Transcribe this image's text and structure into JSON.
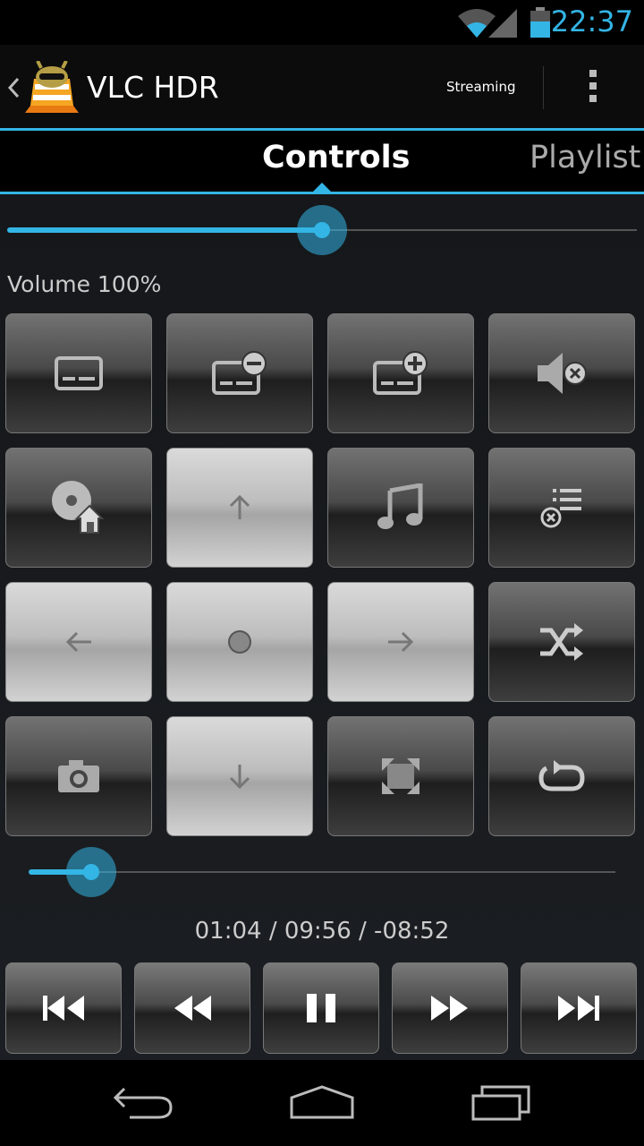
{
  "status_bar": {
    "time": "22:37"
  },
  "action_bar": {
    "title": "VLC HDR",
    "streaming_label": "Streaming"
  },
  "tabs": [
    {
      "label": "Controls",
      "selected": true
    },
    {
      "label": "Playlist",
      "selected": false
    }
  ],
  "volume": {
    "label": "Volume 100%",
    "level": 0.5
  },
  "seek": {
    "time_text": "01:04 / 09:56 / -08:52",
    "position": 0.107
  },
  "control_buttons": [
    "subtitles-icon",
    "subtitle-delay-minus-icon",
    "subtitle-delay-plus-icon",
    "mute-icon",
    "dvd-menu-home-icon",
    "arrow-up-icon",
    "audio-track-icon",
    "clear-playlist-icon",
    "arrow-left-icon",
    "select-dot-icon",
    "arrow-right-icon",
    "shuffle-icon",
    "camera-snapshot-icon",
    "arrow-down-icon",
    "fullscreen-icon",
    "repeat-icon"
  ],
  "playback_buttons": [
    "skip-previous-icon",
    "rewind-icon",
    "pause-icon",
    "fast-forward-icon",
    "skip-next-icon"
  ],
  "colors": {
    "accent": "#33b5e5",
    "background": "#000000"
  }
}
